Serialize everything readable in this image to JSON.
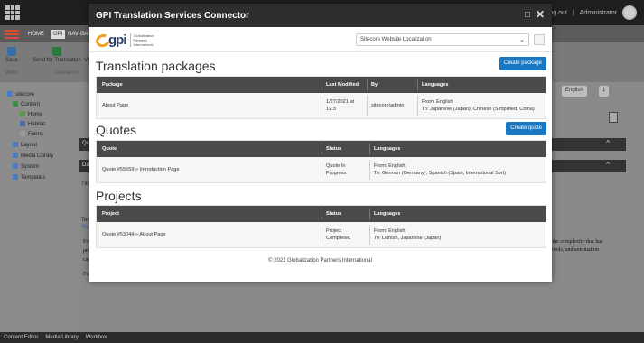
{
  "app": {
    "topbar": {
      "logout": "Log out",
      "divider": "|",
      "user": "Administrator"
    },
    "ribbon_tabs": [
      "HOME",
      "GPI",
      "NAVIGATE"
    ],
    "ribbon": {
      "save": "Save",
      "send": "Send for Translation",
      "view": "Vie",
      "write": "Write",
      "connector": "Connector"
    },
    "tree": [
      "sitecore",
      "Content",
      "Home",
      "Habitat",
      "Forms",
      "Layout",
      "Media Library",
      "System",
      "Templates"
    ],
    "right_buttons": {
      "language": "English",
      "version": "1"
    },
    "panel_labels": [
      "Qu",
      "Dat",
      "Title",
      "Text",
      "Shi"
    ],
    "paragraphs": {
      "left": [
        "Fo",
        "pro",
        "cap",
        "Fo"
      ],
      "right": [
        "f the complexity that has",
        "l tools, and automation"
      ]
    },
    "bottom_tabs": [
      "Content Editor",
      "Media Library",
      "Workbox"
    ]
  },
  "dialog": {
    "title": "GPI Translation Services Connector",
    "controls": {
      "minimize": "□",
      "close": "✕"
    },
    "logo": {
      "word": "gpi",
      "tagline": [
        "Globalization",
        "Partners",
        "International"
      ]
    },
    "project_select": {
      "value": "Sitecore Website Localization",
      "chevron": "⌄"
    },
    "packages": {
      "title": "Translation packages",
      "button": "Create package",
      "headers": [
        "Package",
        "Last Modified",
        "By",
        "Languages"
      ],
      "rows": [
        {
          "package": "About Page",
          "modified": "1/27/2021 at 12:3",
          "by": "sitecore\\admin",
          "from": "From: English",
          "to": "To: Japanese (Japan), Chinese (Simplified, China)"
        }
      ]
    },
    "quotes": {
      "title": "Quotes",
      "button": "Create quote",
      "headers": [
        "Quote",
        "Status",
        "Languages"
      ],
      "rows": [
        {
          "quote": "Quote #55659 » Introduction Page",
          "status": "Quote In Progress",
          "from": "From: English",
          "to": "To: German (Germany), Spanish (Spain, International Sort)"
        }
      ]
    },
    "projects": {
      "title": "Projects",
      "headers": [
        "Project",
        "Status",
        "Languages"
      ],
      "rows": [
        {
          "project": "Quote #53044 » About Page",
          "status": "Project Completed",
          "from": "From: English",
          "to": "To: Danish, Japanese (Japan)"
        }
      ]
    },
    "footer": "© 2021 Globalization Partners International"
  },
  "colors": {
    "accent_blue": "#1a78c2",
    "header_dark": "#2e2e2e",
    "brand_orange": "#f0a020",
    "sitecore_red": "#d84c35"
  }
}
